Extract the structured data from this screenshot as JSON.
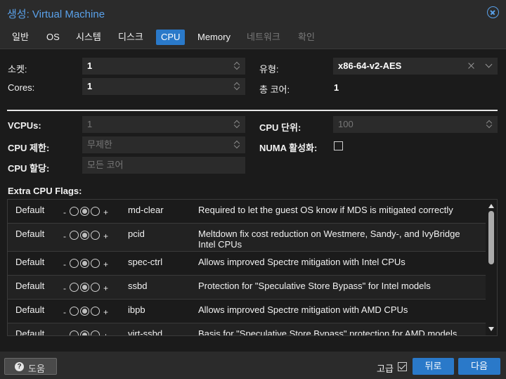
{
  "window": {
    "title": "생성: Virtual Machine"
  },
  "tabs": [
    {
      "label": "일반"
    },
    {
      "label": "OS"
    },
    {
      "label": "시스템"
    },
    {
      "label": "디스크"
    },
    {
      "label": "CPU"
    },
    {
      "label": "Memory"
    },
    {
      "label": "네트워크"
    },
    {
      "label": "확인"
    }
  ],
  "active_tab": "CPU",
  "form": {
    "sockets_label": "소켓:",
    "sockets_value": "1",
    "cores_label": "Cores:",
    "cores_value": "1",
    "type_label": "유형:",
    "type_value": "x86-64-v2-AES",
    "total_cores_label": "총 코어:",
    "total_cores_value": "1",
    "vcpus_label": "VCPUs:",
    "vcpus_value": "1",
    "cpu_units_label": "CPU 단위:",
    "cpu_units_value": "100",
    "cpu_limit_label": "CPU 제한:",
    "cpu_limit_value": "무제한",
    "numa_label": "NUMA 활성화:",
    "cpu_affinity_label": "CPU 할당:",
    "cpu_affinity_placeholder": "모든 코어",
    "extra_flags_label": "Extra CPU Flags:"
  },
  "flags": [
    {
      "state": "Default",
      "minus": "-",
      "plus": "+",
      "name": "md-clear",
      "description": "Required to let the guest OS know if MDS is mitigated correctly"
    },
    {
      "state": "Default",
      "minus": "-",
      "plus": "+",
      "name": "pcid",
      "description": "Meltdown fix cost reduction on Westmere, Sandy-, and IvyBridge Intel CPUs"
    },
    {
      "state": "Default",
      "minus": "-",
      "plus": "+",
      "name": "spec-ctrl",
      "description": "Allows improved Spectre mitigation with Intel CPUs"
    },
    {
      "state": "Default",
      "minus": "-",
      "plus": "+",
      "name": "ssbd",
      "description": "Protection for \"Speculative Store Bypass\" for Intel models"
    },
    {
      "state": "Default",
      "minus": "-",
      "plus": "+",
      "name": "ibpb",
      "description": "Allows improved Spectre mitigation with AMD CPUs"
    },
    {
      "state": "Default",
      "minus": "-",
      "plus": "+",
      "name": "virt-ssbd",
      "description": "Basis for \"Speculative Store Bypass\" protection for AMD models"
    }
  ],
  "footer": {
    "help_label": "도움",
    "advanced_label": "고급",
    "advanced_checked": true,
    "back_label": "뒤로",
    "next_label": "다음"
  },
  "colors": {
    "accent": "#2a79c9",
    "title": "#5aa1ea",
    "background": "#1b1b1b",
    "panel": "#2b2b2b"
  }
}
